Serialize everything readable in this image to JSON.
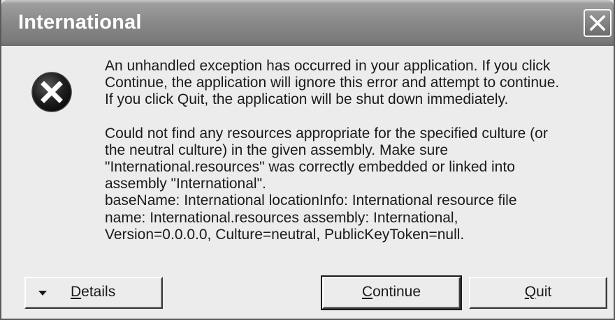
{
  "window": {
    "title": "International"
  },
  "message": {
    "paragraph1": "An unhandled exception has occurred in your application. If you click\nContinue, the application will ignore this error and attempt to continue.\nIf you click Quit, the application will be shut down immediately.",
    "paragraph2": "Could not find any resources appropriate for the specified culture (or\nthe neutral culture) in the given assembly.  Make sure\n\"International.resources\" was correctly embedded or linked into\nassembly \"International\".\nbaseName: International  locationInfo: International  resource file\nname: International.resources  assembly: International,\nVersion=0.0.0.0, Culture=neutral, PublicKeyToken=null."
  },
  "buttons": {
    "details": {
      "mnemonic": "D",
      "rest": "etails"
    },
    "continue": {
      "mnemonic": "C",
      "rest": "ontinue"
    },
    "quit": {
      "mnemonic": "Q",
      "rest": "uit"
    }
  },
  "icons": {
    "title_close": "close-icon",
    "error": "error-icon",
    "details_arrow": "triangle-down-icon"
  }
}
